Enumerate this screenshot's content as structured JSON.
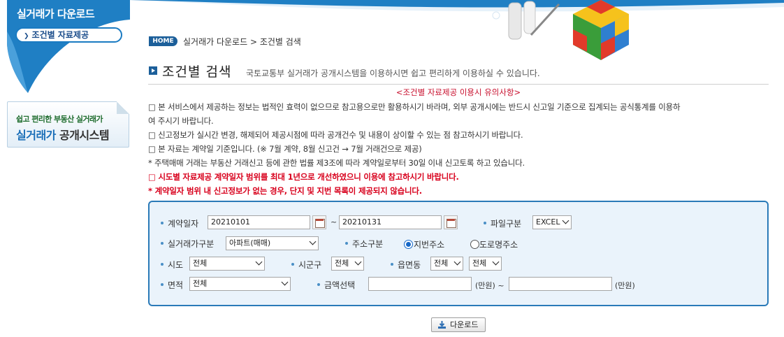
{
  "sidebar": {
    "title": "실거래가 다운로드",
    "menu_item": "조건별 자료제공",
    "banner_sub": "쉽고 편리한 부동산 실거래가",
    "banner_main_blue": "실거래가",
    "banner_main_dark": "공개시스템"
  },
  "breadcrumb": {
    "home": "HOME",
    "path": "실거래가 다운로드 > 조건별 검색"
  },
  "page": {
    "title": "조건별 검색",
    "description": "국토교통부 실거래가 공개시스템을 이용하시면 쉽고 편리하게 이용하실 수 있습니다."
  },
  "notice": {
    "heading": "<조건별 자료제공 이용시 유의사항>",
    "items": [
      {
        "text": "□ 본 서비스에서 제공하는 정보는 법적인 효력이 없으므로 참고용으로만 활용하시기 바라며, 외부 공개시에는 반드시 신고일 기준으로 집계되는 공식통계를 이용하",
        "red": false
      },
      {
        "text": "여 주시기 바랍니다.",
        "red": false
      },
      {
        "text": "□ 신고정보가 실시간 변경, 해제되어 제공시점에 따라 공개건수 및 내용이 상이할 수 있는 점 참고하시기 바랍니다.",
        "red": false
      },
      {
        "text": "□ 본 자료는 계약일 기준입니다. (※ 7월 계약, 8월 신고건 → 7월 거래건으로 제공)",
        "red": false
      },
      {
        "text": "* 주택매매 거래는 부동산 거래신고 등에 관한 법률 제3조에 따라 계약일로부터 30일 이내 신고토록 하고 있습니다.",
        "red": false
      },
      {
        "text": "□ 시도별 자료제공 계약일자 범위를 최대 1년으로 개선하였으니 이용에 참고하시기 바랍니다.",
        "red": true
      },
      {
        "text": "* 계약일자 범위 내 신고정보가 없는 경우, 단지 및 지번 목록이 제공되지 않습니다.",
        "red": true
      }
    ]
  },
  "form": {
    "contract_date_label": "계약일자",
    "date_from": "20210101",
    "date_to": "20210131",
    "tilde": "~",
    "file_type_label": "파일구분",
    "file_type_value": "EXCEL",
    "deal_type_label": "실거래가구분",
    "deal_type_value": "아파트(매매)",
    "address_type_label": "주소구분",
    "address_jibun": "지번주소",
    "address_road": "도로명주소",
    "sido_label": "시도",
    "sido_value": "전체",
    "sigungu_label": "시군구",
    "sigungu_value": "전체",
    "emd_label": "읍면동",
    "emd_value_1": "전체",
    "emd_value_2": "전체",
    "area_label": "면적",
    "area_value": "전체",
    "price_label": "금액선택",
    "price_unit": "(만원)",
    "price_unit_tilde": "(만원) ~"
  },
  "actions": {
    "download_label": "다운로드"
  },
  "colors": {
    "brand_blue": "#1c5f9a",
    "search_border": "#2a7ab8",
    "notice_red": "#d8001c"
  }
}
